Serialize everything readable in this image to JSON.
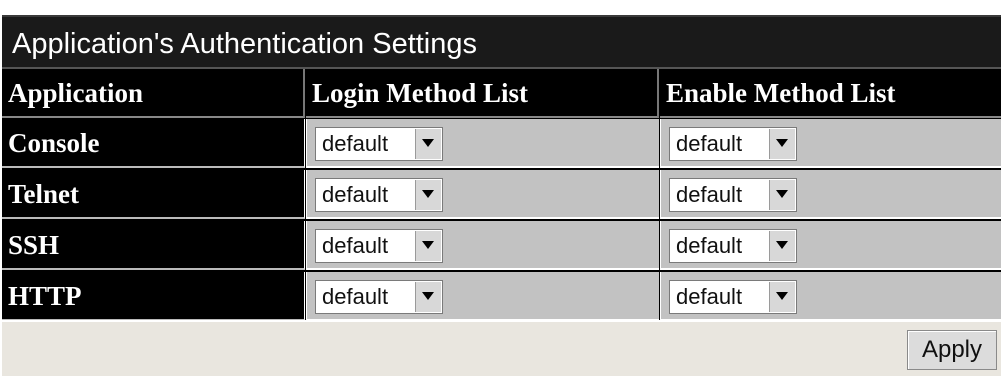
{
  "panel": {
    "title": "Application's Authentication  Settings"
  },
  "table": {
    "columns": [
      "Application",
      "Login Method List",
      "Enable Method List"
    ],
    "rows": [
      {
        "application": "Console",
        "login_method": "default",
        "enable_method": "default"
      },
      {
        "application": "Telnet",
        "login_method": "default",
        "enable_method": "default"
      },
      {
        "application": "SSH",
        "login_method": "default",
        "enable_method": "default"
      },
      {
        "application": "HTTP",
        "login_method": "default",
        "enable_method": "default"
      }
    ]
  },
  "footer": {
    "apply_label": "Apply"
  },
  "colors": {
    "header_bg": "#000000",
    "cell_bg": "#c2c2c2",
    "footer_bg": "#e9e6df"
  },
  "icons": {
    "dropdown": "chevron-down-icon"
  }
}
